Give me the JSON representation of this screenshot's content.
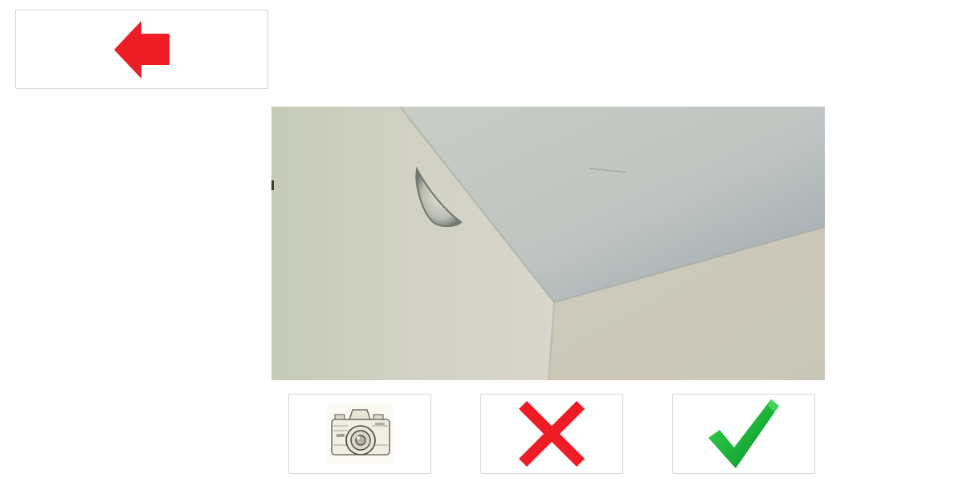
{
  "toolbar": {
    "back_icon": "arrow-left-icon",
    "back_color": "#ee1c25"
  },
  "viewfinder": {
    "subject": "room-corner-ceiling-with-wall-light",
    "wall_color": "#d4d3c6",
    "ceiling_color": "#c7cbc6"
  },
  "actions": {
    "capture_icon": "camera-icon",
    "cancel_icon": "close-icon",
    "cancel_color": "#ee1c25",
    "confirm_icon": "checkmark-icon",
    "confirm_color": "#1db53a"
  }
}
